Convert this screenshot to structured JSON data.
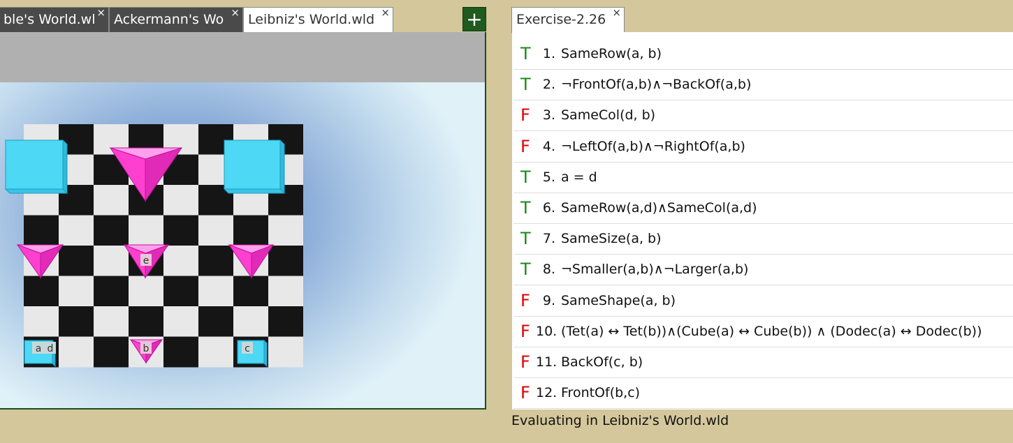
{
  "tabs": [
    {
      "label": "ble's World.wld",
      "active": false
    },
    {
      "label": "Ackermann's Wo",
      "active": false
    },
    {
      "label": "Leibniz's World.wld",
      "active": true
    }
  ],
  "close_glyph": "×",
  "add_tab_label": "+",
  "sentence_tab": {
    "label": "Exercise-2.26"
  },
  "world": {
    "labels": {
      "a": "a",
      "d": "d",
      "b": "b",
      "c": "c",
      "e": "e"
    },
    "colors": {
      "cube": "#4dd8f5",
      "tet": "#ff3fcf",
      "dark_square": "#151515",
      "light_square": "#e8e8e8"
    }
  },
  "sentences": [
    {
      "truth": "T",
      "num": "1.",
      "formula": "SameRow(a, b)"
    },
    {
      "truth": "T",
      "num": "2.",
      "formula": "¬FrontOf(a,b)∧¬BackOf(a,b)"
    },
    {
      "truth": "F",
      "num": "3.",
      "formula": "SameCol(d, b)"
    },
    {
      "truth": "F",
      "num": "4.",
      "formula": "¬LeftOf(a,b)∧¬RightOf(a,b)"
    },
    {
      "truth": "T",
      "num": "5.",
      "formula": "a = d"
    },
    {
      "truth": "T",
      "num": "6.",
      "formula": "SameRow(a,d)∧SameCol(a,d)"
    },
    {
      "truth": "T",
      "num": "7.",
      "formula": "SameSize(a, b)"
    },
    {
      "truth": "T",
      "num": "8.",
      "formula": "¬Smaller(a,b)∧¬Larger(a,b)"
    },
    {
      "truth": "F",
      "num": "9.",
      "formula": "SameShape(a, b)"
    },
    {
      "truth": "F",
      "num": "10.",
      "formula": "(Tet(a) ↔ Tet(b))∧(Cube(a) ↔ Cube(b)) ∧ (Dodec(a) ↔ Dodec(b))"
    },
    {
      "truth": "F",
      "num": "11.",
      "formula": "BackOf(c, b)"
    },
    {
      "truth": "F",
      "num": "12.",
      "formula": "FrontOf(b,c)"
    }
  ],
  "status": "Evaluating in Leibniz's World.wld"
}
